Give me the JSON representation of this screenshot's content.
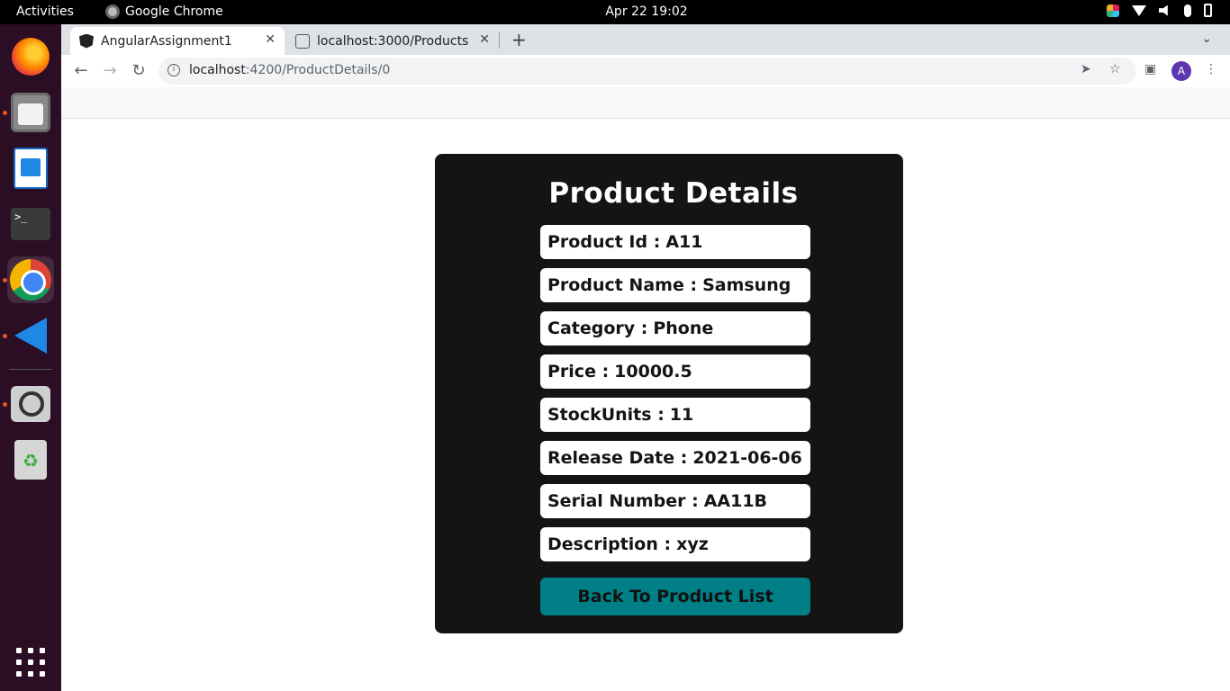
{
  "system": {
    "activities": "Activities",
    "app_name": "Google Chrome",
    "clock": "Apr 22  19:02"
  },
  "dock": {
    "items": [
      "firefox",
      "files",
      "libreoffice-writer",
      "terminal",
      "google-chrome",
      "vscode",
      "image-viewer",
      "trash"
    ]
  },
  "browser": {
    "tabs": [
      {
        "title": "AngularAssignment1",
        "active": true
      },
      {
        "title": "localhost:3000/Products",
        "active": false
      }
    ],
    "url_host": "localhost",
    "url_path": ":4200/ProductDetails/0",
    "profile_initial": "A"
  },
  "page": {
    "title": "Product Details",
    "fields": [
      {
        "label": "Product Id :",
        "value": "A11"
      },
      {
        "label": "Product Name :",
        "value": "Samsung"
      },
      {
        "label": "Category :",
        "value": "Phone"
      },
      {
        "label": "Price :",
        "value": "10000.5"
      },
      {
        "label": "StockUnits :",
        "value": "11"
      },
      {
        "label": "Release Date :",
        "value": "2021-06-06"
      },
      {
        "label": "Serial Number :",
        "value": "AA11B"
      },
      {
        "label": "Description :",
        "value": "xyz"
      }
    ],
    "back_button": "Back To Product List"
  },
  "colors": {
    "card_bg": "#141414",
    "button_bg": "#007f86",
    "dock_bg": "#2b0d24",
    "running_indicator": "#e95420"
  }
}
